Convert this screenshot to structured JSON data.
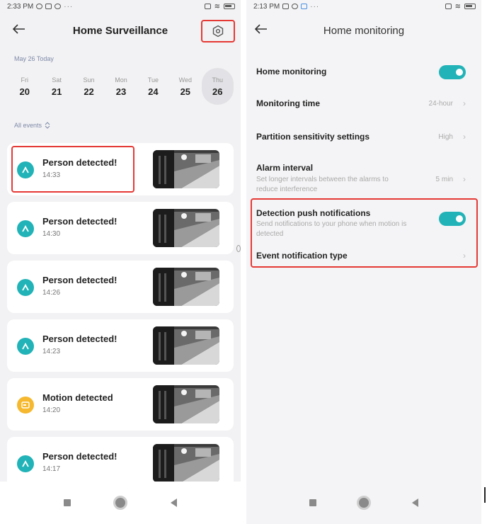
{
  "left": {
    "status": {
      "time": "2:33 PM",
      "battery": "65"
    },
    "header": {
      "title": "Home Surveillance"
    },
    "date_label": "May 26 Today",
    "days": [
      {
        "name": "Fri",
        "num": "20"
      },
      {
        "name": "Sat",
        "num": "21"
      },
      {
        "name": "Sun",
        "num": "22"
      },
      {
        "name": "Mon",
        "num": "23"
      },
      {
        "name": "Tue",
        "num": "24"
      },
      {
        "name": "Wed",
        "num": "25"
      },
      {
        "name": "Thu",
        "num": "26"
      }
    ],
    "selected_day": "Thu",
    "filter_label": "All events",
    "events": [
      {
        "title": "Person detected!",
        "time": "14:33",
        "icon": "person-icon",
        "color": "#21b3b7"
      },
      {
        "title": "Person detected!",
        "time": "14:30",
        "icon": "person-icon",
        "color": "#21b3b7"
      },
      {
        "title": "Person detected!",
        "time": "14:26",
        "icon": "person-icon",
        "color": "#21b3b7"
      },
      {
        "title": "Person detected!",
        "time": "14:23",
        "icon": "person-icon",
        "color": "#21b3b7"
      },
      {
        "title": "Motion detected",
        "time": "14:20",
        "icon": "motion-icon",
        "color": "#f5b82e"
      },
      {
        "title": "Person detected!",
        "time": "14:17",
        "icon": "person-icon",
        "color": "#21b3b7"
      }
    ]
  },
  "right": {
    "status": {
      "time": "2:13 PM",
      "battery": "69"
    },
    "header": {
      "title": "Home monitoring"
    },
    "settings": {
      "home_monitoring": {
        "title": "Home monitoring",
        "enabled": true
      },
      "monitoring_time": {
        "title": "Monitoring time",
        "value": "24-hour"
      },
      "partition_sensitivity": {
        "title": "Partition sensitivity settings",
        "value": "High"
      },
      "alarm_interval": {
        "title": "Alarm interval",
        "desc": "Set longer intervals between the alarms to reduce interference",
        "value": "5 min"
      },
      "detection_push": {
        "title": "Detection push notifications",
        "desc": "Send notifications to your phone when motion is detected",
        "enabled": true
      },
      "event_notification_type": {
        "title": "Event notification type"
      }
    }
  },
  "colors": {
    "accent": "#21b3b7",
    "highlight": "#e53935",
    "motion": "#f5b82e"
  }
}
